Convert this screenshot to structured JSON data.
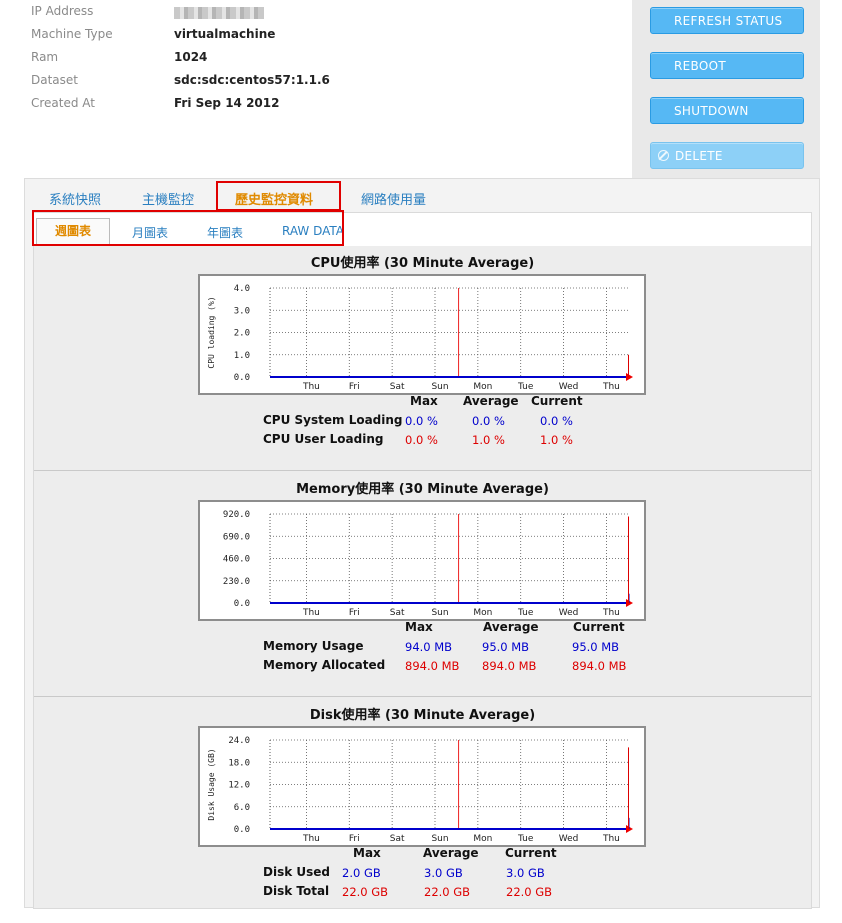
{
  "info": {
    "rows": [
      {
        "key": "IP Address",
        "value": ""
      },
      {
        "key": "Machine Type",
        "value": "virtualmachine"
      },
      {
        "key": "Ram",
        "value": "1024"
      },
      {
        "key": "Dataset",
        "value": "sdc:sdc:centos57:1.1.6"
      },
      {
        "key": "Created At",
        "value": "Fri Sep 14 2012"
      }
    ]
  },
  "actions": {
    "refresh": "REFRESH STATUS",
    "reboot": "REBOOT",
    "shutdown": "SHUTDOWN",
    "delete": "DELETE"
  },
  "tabs": [
    "系統快照",
    "主機監控",
    "歷史監控資料",
    "網路使用量"
  ],
  "subtabs": [
    "週圖表",
    "月圖表",
    "年圖表",
    "RAW DATA"
  ],
  "stat_headers": {
    "max": "Max",
    "average": "Average",
    "current": "Current"
  },
  "colors": {
    "blue_value": "#0000cc",
    "red_value": "#dd0000",
    "active_tab": "#e08a00",
    "link": "#2a7fc0",
    "button": "#56b8f4"
  },
  "charts": [
    {
      "title": "CPU使用率 (30 Minute Average)",
      "rows": [
        {
          "label": "CPU System Loading",
          "max": "0.0 %",
          "average": "0.0 %",
          "current": "0.0 %",
          "color": "blue"
        },
        {
          "label": "CPU User Loading",
          "max": "0.0 %",
          "average": "1.0 %",
          "current": "1.0 %",
          "color": "red"
        }
      ]
    },
    {
      "title": "Memory使用率 (30 Minute Average)",
      "rows": [
        {
          "label": "Memory Usage",
          "max": "94.0 MB",
          "average": "95.0 MB",
          "current": "95.0 MB",
          "color": "blue"
        },
        {
          "label": "Memory Allocated",
          "max": "894.0 MB",
          "average": "894.0 MB",
          "current": "894.0 MB",
          "color": "red"
        }
      ]
    },
    {
      "title": "Disk使用率 (30 Minute Average)",
      "rows": [
        {
          "label": "Disk Used",
          "max": "2.0 GB",
          "average": "3.0 GB",
          "current": "3.0 GB",
          "color": "blue"
        },
        {
          "label": "Disk Total",
          "max": "22.0 GB",
          "average": "22.0 GB",
          "current": "22.0 GB",
          "color": "red"
        }
      ]
    }
  ],
  "chart_data": [
    {
      "type": "line",
      "title": "",
      "ylabel": "CPU loading (%)",
      "categories": [
        "Thu",
        "Fri",
        "Sat",
        "Sun",
        "Mon",
        "Tue",
        "Wed",
        "Thu"
      ],
      "yticks": [
        "0.0",
        "1.0",
        "2.0",
        "3.0",
        "4.0"
      ],
      "ylim": [
        0,
        4
      ],
      "grid": true,
      "series": [
        {
          "name": "CPU System Loading",
          "color": "#0000cc",
          "values": [
            0,
            0,
            0,
            0,
            0,
            0,
            0,
            0
          ]
        },
        {
          "name": "CPU User Loading",
          "color": "#dd0000",
          "values": [
            0,
            0,
            0,
            0,
            0,
            0,
            0,
            1
          ]
        }
      ]
    },
    {
      "type": "line",
      "title": "",
      "ylabel": "",
      "categories": [
        "Thu",
        "Fri",
        "Sat",
        "Sun",
        "Mon",
        "Tue",
        "Wed",
        "Thu"
      ],
      "yticks": [
        "0.0",
        "230.0",
        "460.0",
        "690.0",
        "920.0"
      ],
      "ylim": [
        0,
        920
      ],
      "grid": true,
      "series": [
        {
          "name": "Memory Usage",
          "color": "#0000cc",
          "values": [
            0,
            0,
            0,
            0,
            0,
            0,
            0,
            95
          ]
        },
        {
          "name": "Memory Allocated",
          "color": "#dd0000",
          "values": [
            0,
            0,
            0,
            0,
            0,
            0,
            0,
            894
          ]
        }
      ]
    },
    {
      "type": "line",
      "title": "",
      "ylabel": "Disk Usage (GB)",
      "categories": [
        "Thu",
        "Fri",
        "Sat",
        "Sun",
        "Mon",
        "Tue",
        "Wed",
        "Thu"
      ],
      "yticks": [
        "0.0",
        "6.0",
        "12.0",
        "18.0",
        "24.0"
      ],
      "ylim": [
        0,
        24
      ],
      "grid": true,
      "series": [
        {
          "name": "Disk Used",
          "color": "#0000cc",
          "values": [
            0,
            0,
            0,
            0,
            0,
            0,
            0,
            3
          ]
        },
        {
          "name": "Disk Total",
          "color": "#dd0000",
          "values": [
            0,
            0,
            0,
            0,
            0,
            0,
            0,
            22
          ]
        }
      ]
    }
  ]
}
